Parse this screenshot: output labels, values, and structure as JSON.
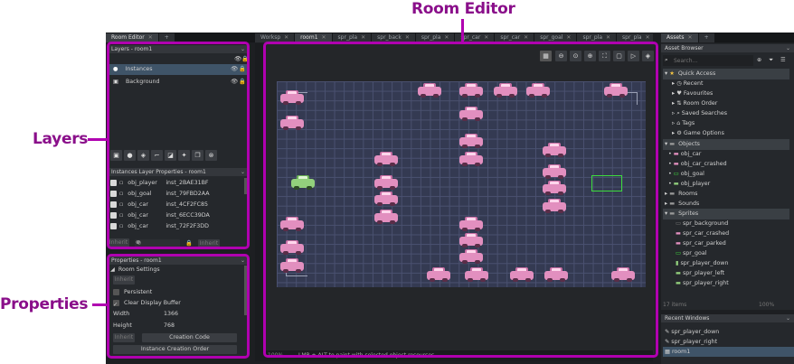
{
  "callouts": {
    "room_editor": "Room Editor",
    "layers": "Layers",
    "properties": "Properties"
  },
  "left_tabs": {
    "room_editor": "Room Editor",
    "add": "+"
  },
  "layers_panel": {
    "title": "Layers - room1",
    "layers": [
      {
        "name": "Instances",
        "selected": true
      },
      {
        "name": "Background",
        "selected": false
      }
    ]
  },
  "instances_panel": {
    "title": "Instances Layer Properties - room1",
    "rows": [
      {
        "object": "obj_player",
        "instance": "inst_2BAE31BF"
      },
      {
        "object": "obj_goal",
        "instance": "inst_79FBD2AA"
      },
      {
        "object": "obj_car",
        "instance": "inst_4CF2FC85"
      },
      {
        "object": "obj_car",
        "instance": "inst_6ECC39DA"
      },
      {
        "object": "obj_car",
        "instance": "inst_72F2F3DD"
      }
    ],
    "depth_label": "Depth",
    "depth_value": "0",
    "inherit_label": "Inherit",
    "inherit_label2": "Inherit"
  },
  "properties_panel": {
    "title": "Properties - room1",
    "section": "Room Settings",
    "inherit": "Inherit",
    "persistent_label": "Persistent",
    "clear_display_label": "Clear Display Buffer",
    "width_label": "Width",
    "width_value": "1366",
    "height_label": "Height",
    "height_value": "768",
    "inherit2": "Inherit",
    "creation_code": "Creation Code",
    "instance_order": "Instance Creation Order"
  },
  "editor_tabs": [
    {
      "label": "Worksp",
      "active": false
    },
    {
      "label": "room1",
      "active": true
    },
    {
      "label": "spr_pla",
      "active": false
    },
    {
      "label": "spr_back",
      "active": false
    },
    {
      "label": "spr_pla",
      "active": false
    },
    {
      "label": "spr_car",
      "active": false
    },
    {
      "label": "spr_car",
      "active": false
    },
    {
      "label": "spr_goal",
      "active": false
    },
    {
      "label": "spr_pla",
      "active": false
    },
    {
      "label": "spr_pla",
      "active": false
    }
  ],
  "status_bar": {
    "zoom": "100%",
    "hint": "LMB + ALT to paint with selected object resources"
  },
  "assets_tabs": {
    "assets": "Assets",
    "add": "+"
  },
  "asset_browser": {
    "title": "Asset Browser",
    "search_placeholder": "Search...",
    "quick_access": "Quick Access",
    "quick_items": [
      "Recent",
      "Favourites",
      "Room Order",
      "Saved Searches",
      "Tags",
      "Game Options"
    ],
    "objects_group": "Objects",
    "objects": [
      "obj_car",
      "obj_car_crashed",
      "obj_goal",
      "obj_player"
    ],
    "rooms_group": "Rooms",
    "sounds_group": "Sounds",
    "sprites_group": "Sprites",
    "sprites": [
      "spr_background",
      "spr_car_crashed",
      "spr_car_parked",
      "spr_goal",
      "spr_player_down",
      "spr_player_left",
      "spr_player_right"
    ],
    "item_count": "17 items",
    "zoom": "100%"
  },
  "recent_windows": {
    "title": "Recent Windows",
    "items": [
      "spr_player_down",
      "spr_player_right",
      "room1"
    ]
  },
  "colors": {
    "accent": "#b000b0",
    "callout_text": "#8a0f8a",
    "car": "#e28fbf",
    "player_car": "#92d07c",
    "goal": "#3ddc3d"
  }
}
